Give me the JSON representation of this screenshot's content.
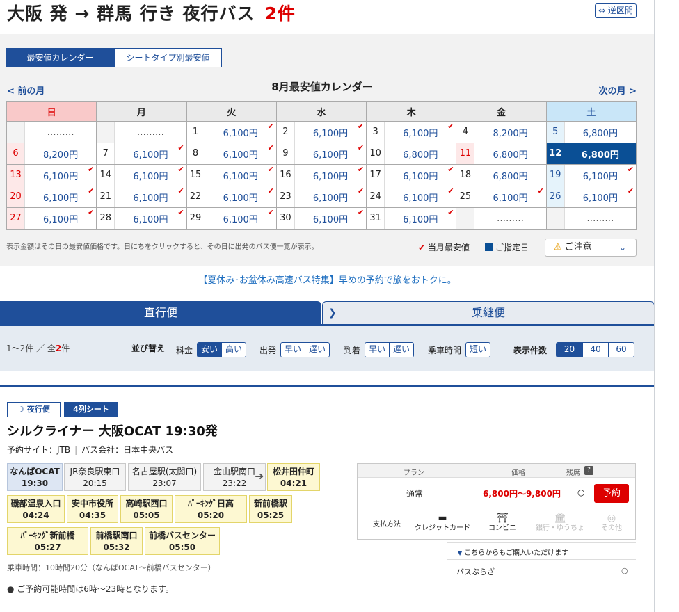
{
  "header": {
    "title": "大阪 発 → 群馬 行き 夜行バス",
    "count": "2件",
    "reverse_label": "⇔ 逆区間"
  },
  "calendar": {
    "tabs": [
      "最安値カレンダー",
      "シートタイプ別最安値"
    ],
    "prev": "< 前の月",
    "next": "次の月 >",
    "title": "8月最安値カレンダー",
    "weekdays": [
      "日",
      "月",
      "火",
      "水",
      "木",
      "金",
      "土"
    ],
    "weeks": [
      [
        {
          "d": "",
          "p": "………"
        },
        {
          "d": "",
          "p": "………"
        },
        {
          "d": "1",
          "p": "6,100円",
          "c": true
        },
        {
          "d": "2",
          "p": "6,100円",
          "c": true
        },
        {
          "d": "3",
          "p": "6,100円",
          "c": true
        },
        {
          "d": "4",
          "p": "8,200円"
        },
        {
          "d": "5",
          "p": "6,800円"
        }
      ],
      [
        {
          "d": "6",
          "p": "8,200円"
        },
        {
          "d": "7",
          "p": "6,100円",
          "c": true
        },
        {
          "d": "8",
          "p": "6,100円",
          "c": true
        },
        {
          "d": "9",
          "p": "6,100円",
          "c": true
        },
        {
          "d": "10",
          "p": "6,800円"
        },
        {
          "d": "11",
          "p": "6,800円",
          "h": true
        },
        {
          "d": "12",
          "p": "6,800円",
          "s": true
        }
      ],
      [
        {
          "d": "13",
          "p": "6,100円",
          "c": true
        },
        {
          "d": "14",
          "p": "6,100円",
          "c": true
        },
        {
          "d": "15",
          "p": "6,100円",
          "c": true
        },
        {
          "d": "16",
          "p": "6,100円",
          "c": true
        },
        {
          "d": "17",
          "p": "6,100円",
          "c": true
        },
        {
          "d": "18",
          "p": "6,800円"
        },
        {
          "d": "19",
          "p": "6,100円",
          "c": true
        }
      ],
      [
        {
          "d": "20",
          "p": "6,100円",
          "c": true
        },
        {
          "d": "21",
          "p": "6,100円",
          "c": true
        },
        {
          "d": "22",
          "p": "6,100円",
          "c": true
        },
        {
          "d": "23",
          "p": "6,100円",
          "c": true
        },
        {
          "d": "24",
          "p": "6,100円",
          "c": true
        },
        {
          "d": "25",
          "p": "6,100円",
          "c": true
        },
        {
          "d": "26",
          "p": "6,100円",
          "c": true
        }
      ],
      [
        {
          "d": "27",
          "p": "6,100円",
          "c": true
        },
        {
          "d": "28",
          "p": "6,100円",
          "c": true
        },
        {
          "d": "29",
          "p": "6,100円",
          "c": true
        },
        {
          "d": "30",
          "p": "6,100円",
          "c": true
        },
        {
          "d": "31",
          "p": "6,100円",
          "c": true
        },
        {
          "d": "",
          "p": "………"
        },
        {
          "d": "",
          "p": "………"
        }
      ]
    ],
    "note": "表示金額はその日の最安値価格です。日にちをクリックすると、その日に出発のバス便一覧が表示。",
    "legend_lowest": "当月最安値",
    "legend_selected": "ご指定日",
    "caution": "ご注意"
  },
  "promo": "【夏休み･お盆休み高速バス特集】早めの予約で旅をおトクに。",
  "tabs": {
    "direct": "直行便",
    "transfer": "乗継便"
  },
  "sortbar": {
    "range": "1〜2件 ／ 全",
    "range_count": "2",
    "range_suffix": "件",
    "sort_label": "並び替え",
    "price_label": "料金",
    "price_opts": [
      "安い",
      "高い"
    ],
    "dep_label": "出発",
    "dep_opts": [
      "早い",
      "遅い"
    ],
    "arr_label": "到着",
    "arr_opts": [
      "早い",
      "遅い"
    ],
    "time_label": "乗車時間",
    "time_opts": [
      "短い"
    ],
    "count_label": "表示件数",
    "count_opts": [
      "20",
      "40",
      "60"
    ]
  },
  "result": {
    "badge_night": "夜行便",
    "badge_seat": "4列シート",
    "title": "シルクライナー 大阪OCAT 19:30発",
    "site": "予約サイト：JTB",
    "company": "バス会社：日本中央バス",
    "stops": [
      {
        "n": "なんばOCAT",
        "t": "19:30"
      },
      {
        "n": "JR奈良駅東口",
        "t": "20:15"
      },
      {
        "n": "名古屋駅(太閤口)",
        "t": "23:07"
      },
      {
        "n": "金山駅南口",
        "t": "23:22"
      },
      {
        "n": "松井田仲町",
        "t": "04:21"
      },
      {
        "n": "磯部温泉入口",
        "t": "04:24"
      },
      {
        "n": "安中市役所",
        "t": "04:35"
      },
      {
        "n": "高崎駅西口",
        "t": "05:05"
      },
      {
        "n": "ﾊﾟｰｷﾝｸﾞ日高",
        "t": "05:20",
        "p": true
      },
      {
        "n": "新前橋駅",
        "t": "05:25"
      },
      {
        "n": "ﾊﾟｰｷﾝｸﾞ新前橋",
        "t": "05:27",
        "p": true
      },
      {
        "n": "前橋駅南口",
        "t": "05:32"
      },
      {
        "n": "前橋バスセンター",
        "t": "05:50"
      }
    ],
    "duration": "乗車時間：10時間20分（なんばOCAT〜前橋バスセンター）",
    "note": "● ご予約可能時間は6時〜23時となります。"
  },
  "plan": {
    "head_plan": "プラン",
    "head_price": "価格",
    "head_seat": "残席",
    "name": "通常",
    "price": "6,800円〜9,800円",
    "seat": "○",
    "reserve": "予約",
    "pay_label": "支払方法",
    "pay": [
      {
        "n": "クレジットカード",
        "on": true
      },
      {
        "n": "コンビニ",
        "on": true
      },
      {
        "n": "銀行・ゆうちょ",
        "on": false
      },
      {
        "n": "その他",
        "on": false
      }
    ]
  },
  "also": {
    "title": "こちらからもご購入いただけます",
    "site": "バスぷらざ",
    "mark": "○"
  }
}
